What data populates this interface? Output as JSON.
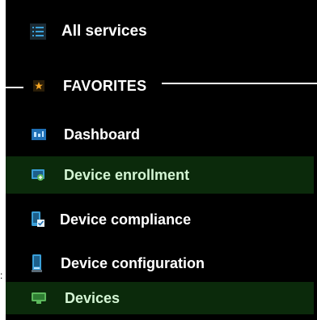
{
  "nav": {
    "all_services": {
      "label": "All services",
      "icon": "list-icon"
    },
    "favorites_header": {
      "label": "FAVORITES",
      "icon": "star-icon",
      "icon_color": "#f5a623"
    },
    "items": [
      {
        "label": "Dashboard",
        "icon": "dashboard-icon",
        "active": false
      },
      {
        "label": "Device enrollment",
        "icon": "device-enrollment-icon",
        "active": true
      },
      {
        "label": "Device compliance",
        "icon": "device-compliance-icon",
        "active": false
      },
      {
        "label": "Device configuration",
        "icon": "device-configuration-icon",
        "active": false
      },
      {
        "label": "Devices",
        "icon": "devices-icon",
        "active": true
      }
    ]
  },
  "colors": {
    "background": "#000000",
    "text": "#ffffff",
    "active_background": "#0b2a0b",
    "accent_blue": "#3a9fd8",
    "accent_green": "#5cb85c"
  },
  "edge_mark": ":"
}
